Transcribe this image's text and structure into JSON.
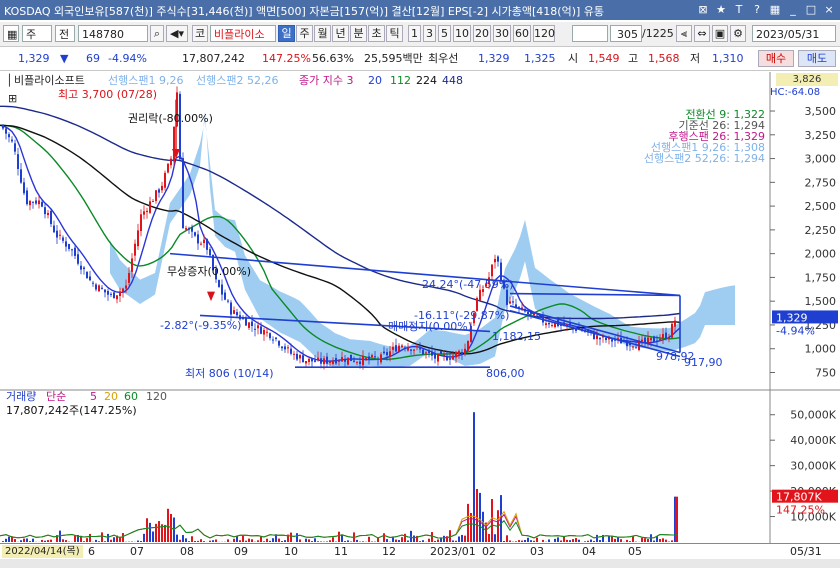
{
  "titlebar": {
    "title": "KOSDAQ 외국인보유[587(천)] 주식수[31,446(천)] 액면[500] 자본금[157(억)] 결산[12월] EPS[-2] 시가총액[418(억)] 유통",
    "icons": [
      "expand-icon",
      "star-icon",
      "text-icon",
      "help-icon",
      "tile-icon",
      "minimize-icon",
      "restore-icon",
      "close-icon"
    ],
    "icon_glyphs": [
      "⊠",
      "★",
      "T",
      "?",
      "▦",
      "_",
      "□",
      "×"
    ]
  },
  "toolbar": {
    "market": "주",
    "order_type": "전",
    "code": "148780",
    "company": "비플라이소",
    "period_tabs": [
      "일",
      "주",
      "월",
      "년",
      "분",
      "초",
      "틱"
    ],
    "active_period": "일",
    "intervals": [
      "1",
      "3",
      "5",
      "10",
      "20",
      "30",
      "60",
      "120"
    ],
    "page": "305",
    "total": "/1225",
    "date": "2023/05/31"
  },
  "quote": {
    "price": "1,329",
    "change": "69",
    "change_pct": "-4.94%",
    "volume": "17,807,242",
    "vol_ratio": "147.25%",
    "turnover": "56.63%",
    "amount": "25,595백만",
    "best_ask_label": "최우선",
    "best_ask1": "1,329",
    "best_ask2": "1,325",
    "open_label": "시",
    "open": "1,549",
    "high_label": "고",
    "high": "1,568",
    "low_label": "저",
    "low": "1,310",
    "buy": "매수",
    "sell": "매도"
  },
  "legend": {
    "name": "비플라이소프트",
    "ichimoku1": "선행스팬1 9,26",
    "ichimoku2": "선행스팬2 52,26",
    "ma_label": "종가 지수 3",
    "ma_vals": [
      "20",
      "112",
      "224",
      "448"
    ],
    "right_box": "3,826",
    "hc": "HC:-64.08"
  },
  "annotations": {
    "high": "최고 3,700 (07/28)",
    "rights": "권리락(-80.00%)",
    "free_inc": "무상증자(0.00%)",
    "angle1": "-2.82°(-9.35%)",
    "angle2": "-16.11°(-29.87%)",
    "angle3": "24.24°(-47.59%)",
    "merge": "매매정지(0.00%)",
    "low_anno": "최저 806 (10/14)",
    "lvl1182": "1,182,15",
    "lvl806": "806,00",
    "lvl978": "978,92",
    "lvl917": "917,90",
    "ichi_lines": [
      "전환선 9: 1,322",
      "기준선 26: 1,294",
      "후행스팬 26: 1,329",
      "선행스팬1 9,26: 1,308",
      "선행스팬2 52,26: 1,294"
    ]
  },
  "price_axis": {
    "ticks": [
      "3,500",
      "3,250",
      "3,000",
      "2,750",
      "2,500",
      "2,250",
      "2,000",
      "1,750",
      "1,500",
      "1,250",
      "1,000",
      "750"
    ],
    "current": "1,329",
    "current_pct": "-4.94%"
  },
  "volume_panel": {
    "label": "거래량",
    "ma_label": "단순",
    "ma_vals": [
      "5",
      "20",
      "60",
      "120"
    ],
    "value": "17,807,242주(147.25%)",
    "ticks": [
      "50,000K",
      "40,000K",
      "30,000K",
      "20,000K",
      "10,000K"
    ],
    "current": "17,807K",
    "current_pct": "147.25%"
  },
  "x_axis": {
    "start_date": "2022/04/14(목)",
    "months": [
      "6",
      "07",
      "08",
      "09",
      "10",
      "11",
      "12",
      "2023/01",
      "02",
      "03",
      "04",
      "05"
    ],
    "end": "05/31"
  },
  "colors": {
    "up": "#e0141a",
    "down": "#1f3fd0",
    "cloud": "#8ec4f0",
    "titlebar": "#4a6fa8"
  },
  "chart_data": {
    "type": "candlestick",
    "title": "",
    "y_range": [
      700,
      3700
    ],
    "close_series_approx": [
      {
        "x": "2022-04-14",
        "y": 3300
      },
      {
        "x": "2022-05-10",
        "y": 2500
      },
      {
        "x": "2022-06-01",
        "y": 2200
      },
      {
        "x": "2022-06-20",
        "y": 1500
      },
      {
        "x": "2022-07-10",
        "y": 2500
      },
      {
        "x": "2022-07-28",
        "y": 3700
      },
      {
        "x": "2022-08-05",
        "y": 2200
      },
      {
        "x": "2022-08-25",
        "y": 1350
      },
      {
        "x": "2022-09-20",
        "y": 1150
      },
      {
        "x": "2022-10-14",
        "y": 806
      },
      {
        "x": "2022-11-15",
        "y": 900
      },
      {
        "x": "2022-12-15",
        "y": 1050
      },
      {
        "x": "2023-01-10",
        "y": 950
      },
      {
        "x": "2023-02-01",
        "y": 2000
      },
      {
        "x": "2023-02-20",
        "y": 1450
      },
      {
        "x": "2023-03-15",
        "y": 1300
      },
      {
        "x": "2023-04-15",
        "y": 1150
      },
      {
        "x": "2023-05-15",
        "y": 1050
      },
      {
        "x": "2023-05-31",
        "y": 1329
      }
    ]
  }
}
